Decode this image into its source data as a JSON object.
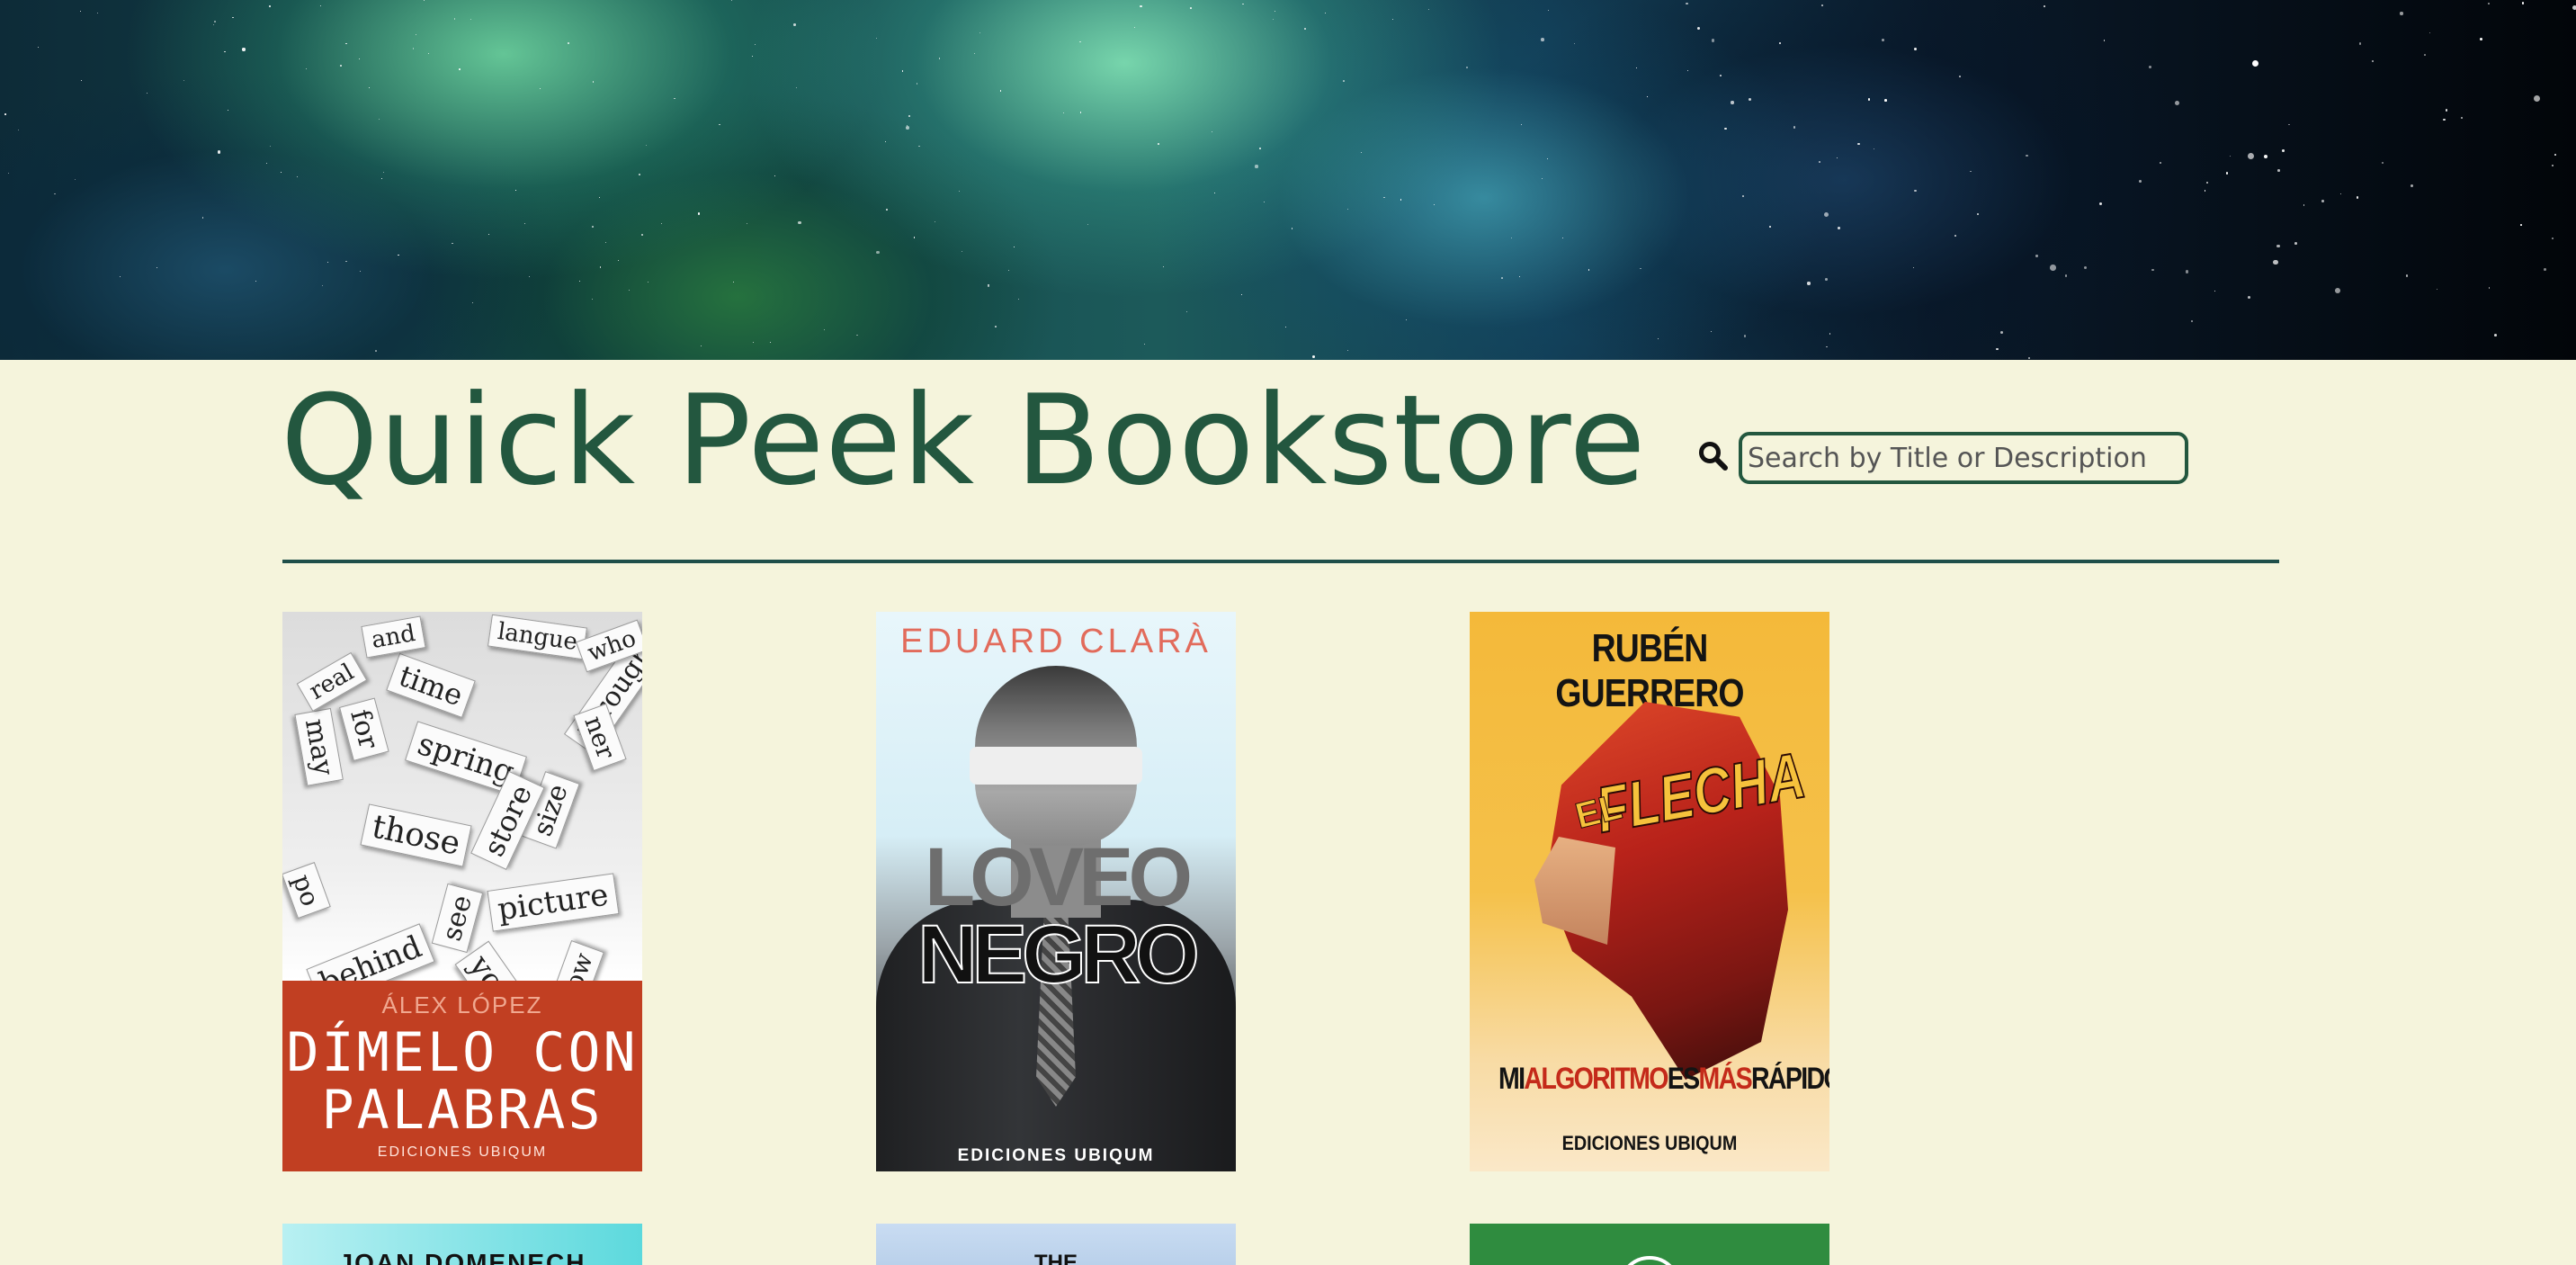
{
  "header": {
    "title": "Quick Peek Bookstore",
    "search_placeholder": "Search by Title or Description",
    "search_value": ""
  },
  "books": [
    {
      "author": "ÁLEX LÓPEZ",
      "title_lines": [
        "DÍMELO CON",
        "PALABRAS"
      ],
      "publisher": "EDICIONES UBIQUM",
      "cover_words": [
        "picture",
        "behind",
        "those",
        "spring",
        "size",
        "through",
        "time",
        "may",
        "store",
        "see",
        "your",
        "for",
        "langue",
        "and",
        "who",
        "ner",
        "real",
        "ow",
        "po"
      ]
    },
    {
      "author": "EDUARD CLARÀ",
      "title_lines": [
        "LOVEO",
        "NEGRO"
      ],
      "publisher": "EDICIONES UBIQUM"
    },
    {
      "author": "RUBÉN GUERRERO",
      "cover_title": "FLECHA",
      "cover_prefix": "EL",
      "subtitle_parts": [
        "MI",
        "ALGORITMO",
        "ES",
        "MÁS",
        "RÁPIDO"
      ],
      "publisher": "EDICIONES UBIQUM"
    }
  ],
  "partial_books": [
    {
      "text": "JOAN DOMENECH"
    },
    {
      "text": "THE"
    },
    {
      "text": ""
    }
  ],
  "colors": {
    "background": "#f5f4dc",
    "accent": "#23573f",
    "divider": "#1f4f4a"
  },
  "icons": {
    "search": "magnifier-icon"
  }
}
